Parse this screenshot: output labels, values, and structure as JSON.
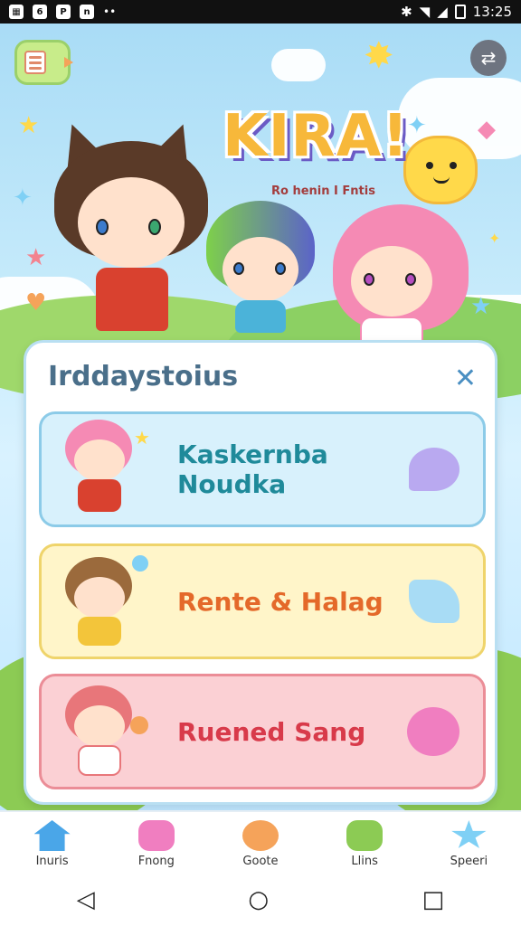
{
  "status_bar": {
    "time": "13:25",
    "left_icons": [
      "notification-icon",
      "app-icon-1",
      "app-icon-2",
      "app-icon-3",
      "dots-icon"
    ],
    "right_icons": [
      "bluetooth-icon",
      "wifi-icon",
      "signal-icon",
      "battery-icon"
    ]
  },
  "header": {
    "logo_text": "KIRA!",
    "logo_subtitle": "Ro henin I Fntis"
  },
  "panel": {
    "title": "Irddaystoius",
    "close_label": "✕",
    "cards": [
      {
        "label": "Kaskernba Noudka",
        "action_icon": "heart-bubble-icon",
        "color": "#1f8a9a"
      },
      {
        "label": "Rente & Halag",
        "action_icon": "music-note-icon",
        "color": "#e4692a"
      },
      {
        "label": "Ruened Sang",
        "action_icon": "cat-face-icon",
        "color": "#d83a4a"
      }
    ]
  },
  "bottom_nav": {
    "items": [
      {
        "label": "Inuris",
        "icon": "home-icon"
      },
      {
        "label": "Fnong",
        "icon": "fish-mascot-icon"
      },
      {
        "label": "Goote",
        "icon": "chick-icon",
        "active": true
      },
      {
        "label": "Llins",
        "icon": "frog-icon"
      },
      {
        "label": "Speeri",
        "icon": "star-badge-icon"
      }
    ]
  },
  "android_nav": {
    "back": "◁",
    "home": "○",
    "recents": "□"
  },
  "colors": {
    "sky": "#a9dcf6",
    "panel_border": "#b9dff2",
    "card1_bg": "#d8f1fc",
    "card2_bg": "#fff5c9",
    "card3_bg": "#fbd0d4"
  }
}
